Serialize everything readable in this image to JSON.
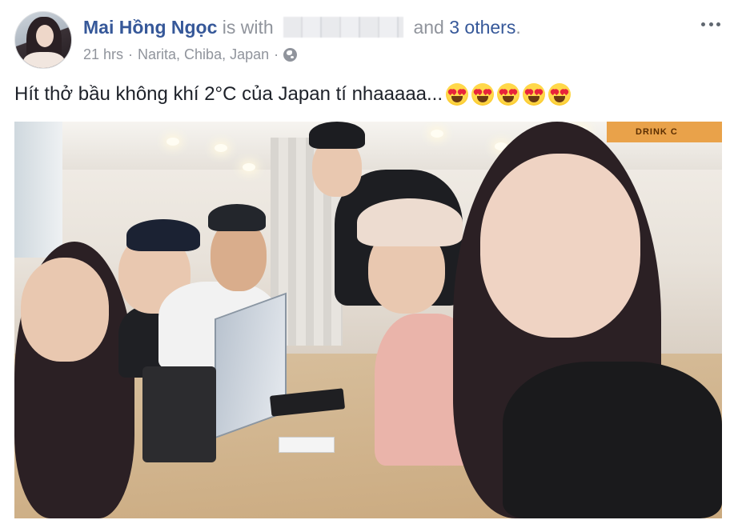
{
  "post": {
    "author": "Mai Hồng Ngọc",
    "with_text": "is with",
    "and_text": "and",
    "others_link": "3 others",
    "period": ".",
    "time": "21 hrs",
    "separator": "·",
    "location": "Narita, Chiba, Japan",
    "privacy_icon": "globe-icon",
    "more_icon": "ellipsis-icon",
    "caption": "Hít thở bầu không khí 2°C của Japan tí nhaaaaa...",
    "emoji_count": 5,
    "emoji_icon": "heart-eyes-emoji",
    "photo_sign_text": "DRINK C"
  },
  "colors": {
    "link": "#365899",
    "meta": "#90949c",
    "text": "#1d2129"
  }
}
